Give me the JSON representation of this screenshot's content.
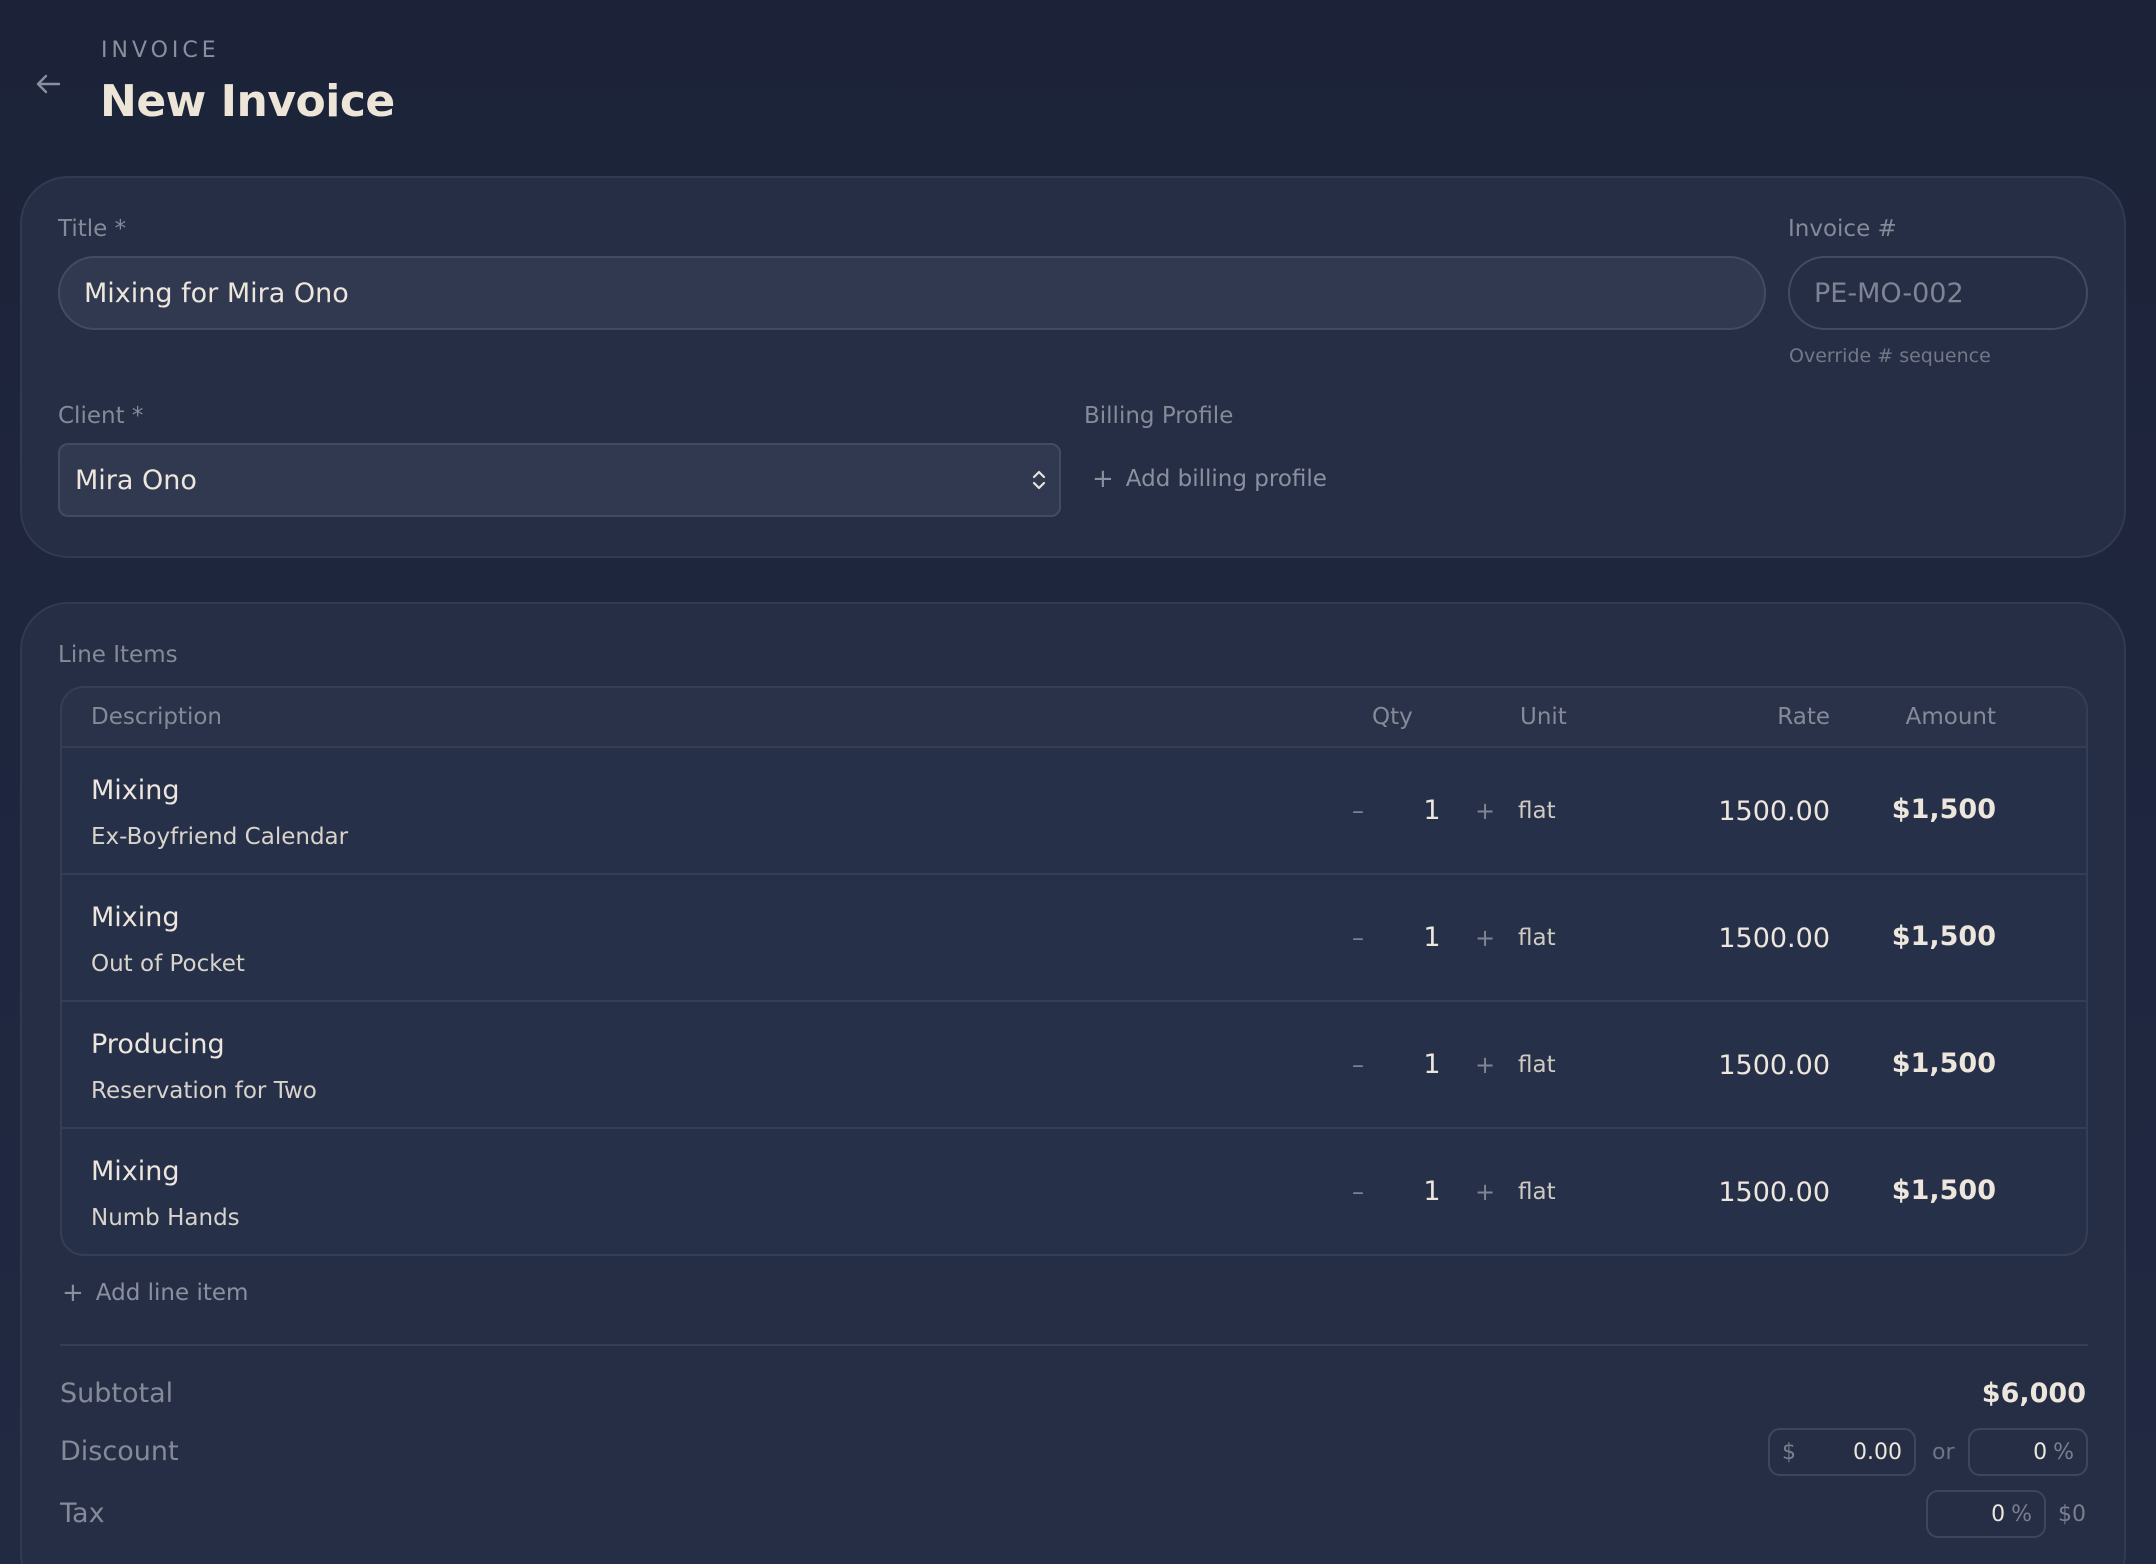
{
  "header": {
    "eyebrow": "INVOICE",
    "title": "New Invoice",
    "back_icon": "arrow-left-icon"
  },
  "form": {
    "title_label": "Title *",
    "title_value": "Mixing for Mira Ono",
    "invoice_label": "Invoice #",
    "invoice_placeholder": "PE-MO-002",
    "invoice_hint": "Override # sequence",
    "client_label": "Client *",
    "client_value": "Mira Ono",
    "billing_label": "Billing Profile",
    "billing_add": "Add billing profile"
  },
  "line_items": {
    "section_label": "Line Items",
    "columns": {
      "description": "Description",
      "qty": "Qty",
      "unit": "Unit",
      "rate": "Rate",
      "amount": "Amount"
    },
    "rows": [
      {
        "service": "Mixing",
        "song": "Ex-Boyfriend Calendar",
        "qty": "1",
        "unit": "flat",
        "rate": "1500.00",
        "amount": "$1,500"
      },
      {
        "service": "Mixing",
        "song": "Out of Pocket",
        "qty": "1",
        "unit": "flat",
        "rate": "1500.00",
        "amount": "$1,500"
      },
      {
        "service": "Producing",
        "song": "Reservation for Two",
        "qty": "1",
        "unit": "flat",
        "rate": "1500.00",
        "amount": "$1,500"
      },
      {
        "service": "Mixing",
        "song": "Numb Hands",
        "qty": "1",
        "unit": "flat",
        "rate": "1500.00",
        "amount": "$1,500"
      }
    ],
    "minus_glyph": "–",
    "plus_glyph": "+",
    "add_label": "Add line item"
  },
  "summary": {
    "subtotal_label": "Subtotal",
    "subtotal_value": "$6,000",
    "discount_label": "Discount",
    "discount_currency": "$",
    "discount_amount": "0.00",
    "discount_or": "or",
    "discount_percent": "0",
    "percent_sign": "%",
    "tax_label": "Tax",
    "tax_percent": "0",
    "tax_amount": "$0"
  },
  "colors": {
    "background": "#1f2740",
    "card": "#262e45",
    "text": "#ece6dc",
    "muted": "#858a98"
  }
}
